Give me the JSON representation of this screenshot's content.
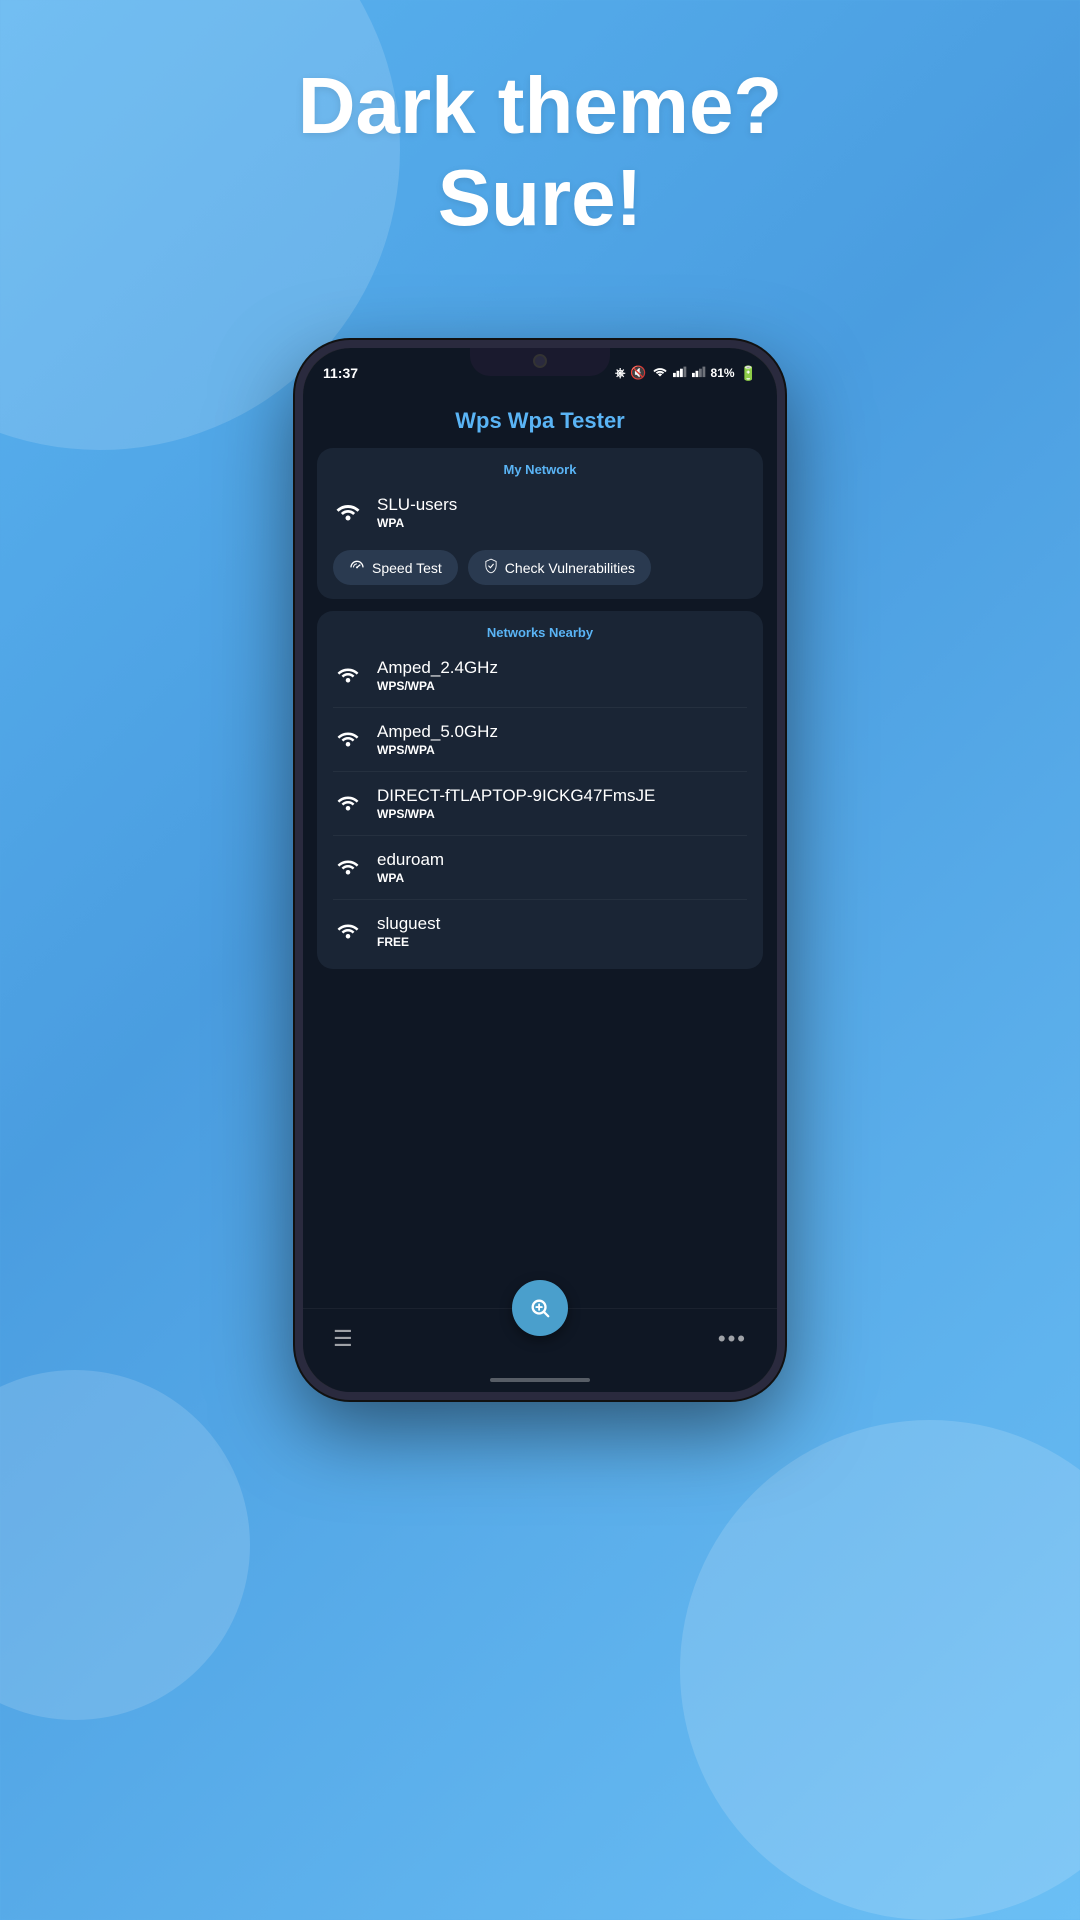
{
  "background": {
    "headline_line1": "Dark theme?",
    "headline_line2": "Sure!"
  },
  "status_bar": {
    "time": "11:37",
    "battery": "81%",
    "icons": [
      "bluetooth",
      "mute",
      "wifi",
      "signal",
      "battery"
    ]
  },
  "app": {
    "title": "Wps Wpa Tester",
    "my_network": {
      "section_label": "My Network",
      "name": "SLU-users",
      "security": "WPA",
      "speed_test_label": "Speed Test",
      "check_vuln_label": "Check Vulnerabilities"
    },
    "networks_nearby": {
      "section_label": "Networks Nearby",
      "networks": [
        {
          "name": "Amped_2.4GHz",
          "security": "WPS/WPA"
        },
        {
          "name": "Amped_5.0GHz",
          "security": "WPS/WPA"
        },
        {
          "name": "DIRECT-fTLAPTOP-9ICKG47FmsJE",
          "security": "WPS/WPA"
        },
        {
          "name": "eduroam",
          "security": "WPA"
        },
        {
          "name": "sluguest",
          "security": "FREE"
        }
      ]
    },
    "fab_icon": "⊕",
    "bottom_nav": {
      "menu_icon": "≡",
      "more_icon": "⋯"
    }
  }
}
